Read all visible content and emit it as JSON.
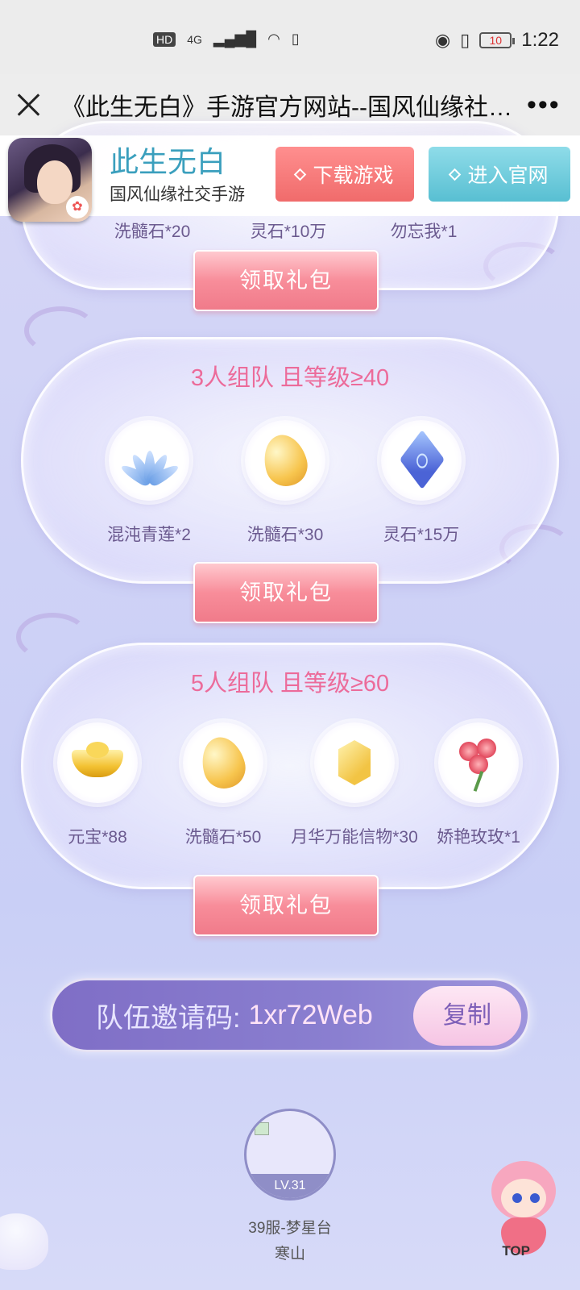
{
  "status_bar": {
    "network": "4G",
    "hd_label": "HD",
    "battery": "10",
    "time": "1:22"
  },
  "nav": {
    "title": "《此生无白》手游官方网站--国风仙缘社交手游",
    "more": "•••"
  },
  "banner": {
    "game_name": "此生无白",
    "tagline": "国风仙缘社交手游",
    "download_label": "下载游戏",
    "official_label": "进入官网"
  },
  "card1": {
    "items": [
      {
        "label": "洗髓石*20",
        "icon": "stone-icon"
      },
      {
        "label": "灵石*10万",
        "icon": "crystal-icon"
      },
      {
        "label": "勿忘我*1",
        "icon": "flower-icon"
      }
    ],
    "claim_label": "领取礼包"
  },
  "card2": {
    "title": "3人组队 且等级≥40",
    "items": [
      {
        "label": "混沌青莲*2",
        "icon": "lotus-icon"
      },
      {
        "label": "洗髓石*30",
        "icon": "stone-icon"
      },
      {
        "label": "灵石*15万",
        "icon": "crystal-icon"
      }
    ],
    "claim_label": "领取礼包"
  },
  "card3": {
    "title": "5人组队 且等级≥60",
    "items": [
      {
        "label": "元宝*88",
        "icon": "ingot-icon"
      },
      {
        "label": "洗髓石*50",
        "icon": "stone-icon"
      },
      {
        "label": "月华万能信物*30",
        "icon": "token-icon"
      },
      {
        "label": "娇艳玫玫*1",
        "icon": "rose-icon"
      }
    ],
    "claim_label": "领取礼包"
  },
  "invite": {
    "label": "队伍邀请码:",
    "code": "1xr72Web",
    "copy_label": "复制"
  },
  "member": {
    "level": "LV.31",
    "server": "39服-梦星台",
    "name": "寒山"
  },
  "top_label": "TOP",
  "colors": {
    "title_pink": "#ec6b9a",
    "banner_blue": "#3a9fbd",
    "download_red": "#f06b6b",
    "official_cyan": "#58bfd2",
    "invite_purple": "#7f6ec6"
  }
}
